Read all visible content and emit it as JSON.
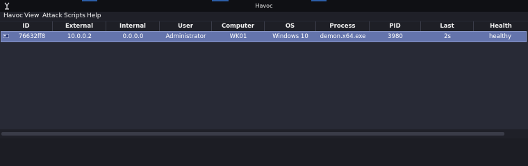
{
  "window": {
    "title": "Havoc",
    "app_icon": "havoc-logo-icon"
  },
  "menu": [
    "Havoc",
    "View",
    "Attack",
    "Scripts",
    "Help"
  ],
  "table": {
    "columns": [
      "ID",
      "External",
      "Internal",
      "User",
      "Computer",
      "OS",
      "Process",
      "PID",
      "Last",
      "Health"
    ],
    "rows": [
      {
        "icon": "agent-icon",
        "selected": true,
        "cells": [
          "76632ff8",
          "10.0.0.2",
          "0.0.0.0",
          "Administrator",
          "WK01",
          "Windows 10",
          "demon.x64.exe",
          "3980",
          "2s",
          "healthy"
        ]
      }
    ]
  },
  "colors": {
    "background": "#282a36",
    "header_bg": "#1e1f26",
    "titlebar_bg": "#0f1014",
    "selected_row": "#6474ac",
    "accent": "#2c5fa8"
  }
}
